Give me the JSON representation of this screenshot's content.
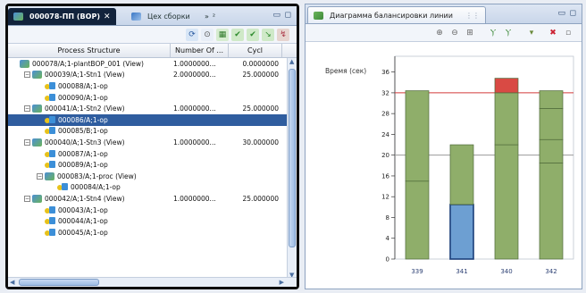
{
  "left_pane": {
    "tabs": [
      {
        "label": "000078-ПП (BOP)",
        "close": "✕"
      },
      {
        "label": "Цех сборки",
        "close": ""
      }
    ],
    "overflow_label": "²",
    "columns": [
      "Process Structure",
      "Number Of ...",
      "Cycl"
    ],
    "rows": [
      {
        "level": 0,
        "expander": "",
        "icon": "group",
        "label": "000078/A;1-plantBOP_001 (View)",
        "num": "1.0000000...",
        "cyc": "0.0000000"
      },
      {
        "level": 1,
        "expander": "−",
        "icon": "group",
        "label": "000039/A;1-Stn1 (View)",
        "num": "2.0000000...",
        "cyc": "25.000000"
      },
      {
        "level": 2,
        "expander": "",
        "icon": "op",
        "label": "000088/A;1-op",
        "num": "",
        "cyc": ""
      },
      {
        "level": 2,
        "expander": "",
        "icon": "op",
        "label": "000090/A;1-op",
        "num": "",
        "cyc": ""
      },
      {
        "level": 1,
        "expander": "−",
        "icon": "group",
        "label": "000041/A;1-Stn2 (View)",
        "num": "1.0000000...",
        "cyc": "25.000000"
      },
      {
        "level": 2,
        "expander": "",
        "icon": "op",
        "label": "000086/A;1-op",
        "num": "",
        "cyc": "",
        "selected": true
      },
      {
        "level": 2,
        "expander": "",
        "icon": "op",
        "label": "000085/B;1-op",
        "num": "",
        "cyc": ""
      },
      {
        "level": 1,
        "expander": "−",
        "icon": "group",
        "label": "000040/A;1-Stn3 (View)",
        "num": "1.0000000...",
        "cyc": "30.000000"
      },
      {
        "level": 2,
        "expander": "",
        "icon": "op",
        "label": "000087/A;1-op",
        "num": "",
        "cyc": ""
      },
      {
        "level": 2,
        "expander": "",
        "icon": "op",
        "label": "000089/A;1-op",
        "num": "",
        "cyc": ""
      },
      {
        "level": 2,
        "expander": "−",
        "icon": "group",
        "label": "000083/A;1-proc (View)",
        "num": "",
        "cyc": ""
      },
      {
        "level": 3,
        "expander": "",
        "icon": "op",
        "label": "000084/A;1-op",
        "num": "",
        "cyc": ""
      },
      {
        "level": 1,
        "expander": "−",
        "icon": "group",
        "label": "000042/A;1-Stn4 (View)",
        "num": "1.0000000...",
        "cyc": "25.000000"
      },
      {
        "level": 2,
        "expander": "",
        "icon": "op",
        "label": "000043/A;1-op",
        "num": "",
        "cyc": ""
      },
      {
        "level": 2,
        "expander": "",
        "icon": "op",
        "label": "000044/A;1-op",
        "num": "",
        "cyc": ""
      },
      {
        "level": 2,
        "expander": "",
        "icon": "op",
        "label": "000045/A;1-op",
        "num": "",
        "cyc": ""
      }
    ]
  },
  "right_pane": {
    "tab_label": "Диаграмма балансировки линии",
    "tab_close": "⋮⋮"
  },
  "colors": {
    "bar_green": "#8fae6a",
    "bar_blue": "#6d9fd2",
    "bar_red": "#d94a44",
    "takt_line": "#d33a3a",
    "ref_line": "#9a9a9a"
  },
  "chart_data": {
    "type": "bar",
    "ylabel": "Время (сек)",
    "ylim": [
      0,
      38
    ],
    "yticks": [
      0,
      4,
      8,
      12,
      16,
      20,
      24,
      28,
      32,
      36
    ],
    "categories": [
      "339",
      "341",
      "340",
      "342"
    ],
    "reference_lines": [
      {
        "value": 32,
        "color": "#d33a3a"
      },
      {
        "value": 20,
        "color": "#9a9a9a"
      }
    ],
    "bars": [
      {
        "category": "339",
        "segments": [
          {
            "value": 15,
            "color": "#8fae6a"
          },
          {
            "value": 17.4,
            "color": "#8fae6a"
          }
        ]
      },
      {
        "category": "341",
        "segments": [
          {
            "value": 10.5,
            "color": "#6d9fd2",
            "highlight": true
          },
          {
            "value": 11.5,
            "color": "#8fae6a"
          }
        ]
      },
      {
        "category": "340",
        "segments": [
          {
            "value": 22,
            "color": "#8fae6a"
          },
          {
            "value": 10,
            "color": "#8fae6a"
          },
          {
            "value": 2.8,
            "color": "#d94a44"
          }
        ]
      },
      {
        "category": "342",
        "segments": [
          {
            "value": 18.5,
            "color": "#8fae6a"
          },
          {
            "value": 4.5,
            "color": "#8fae6a"
          },
          {
            "value": 6,
            "color": "#8fae6a"
          },
          {
            "value": 3.4,
            "color": "#8fae6a"
          }
        ]
      }
    ]
  }
}
